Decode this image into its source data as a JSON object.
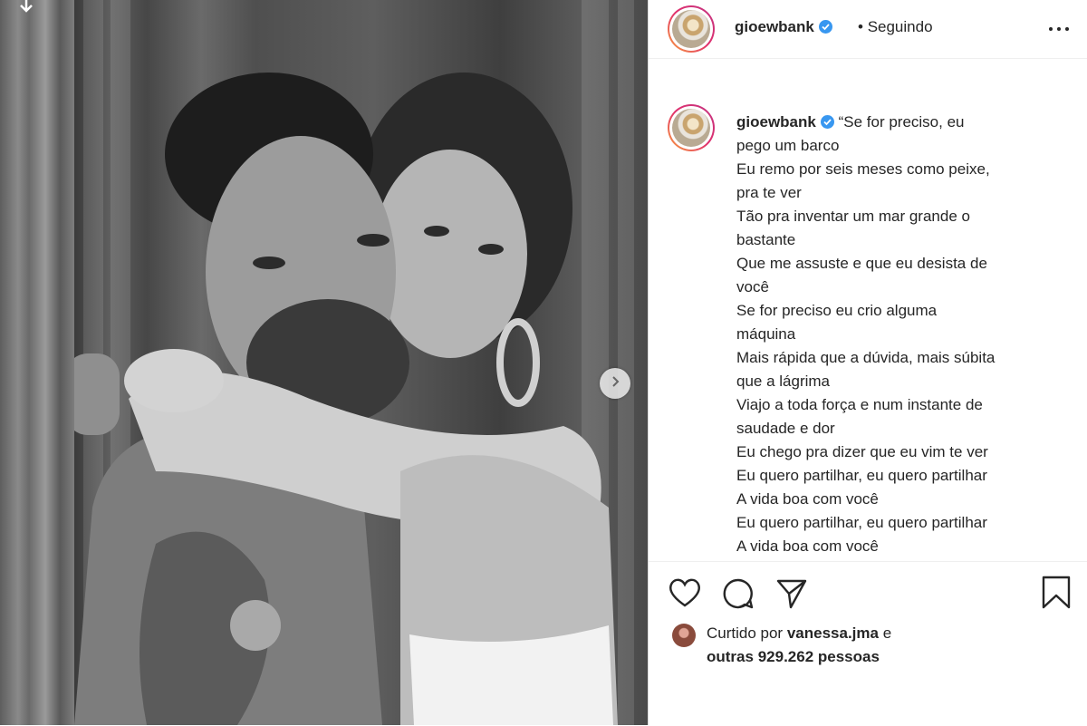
{
  "post": {
    "username": "gioewbank",
    "follow_separator": "•",
    "follow_status": "Seguindo",
    "caption_lines": [
      "“Se for preciso, eu",
      "pego um barco",
      "Eu remo por seis meses como peixe,",
      "pra te ver",
      "Tão pra inventar um mar grande o",
      "bastante",
      "Que me assuste e que eu desista de",
      "você",
      "Se for preciso eu crio alguma",
      "máquina",
      "Mais rápida que a dúvida, mais súbita",
      "que a lágrima",
      "Viajo a toda força e num instante de",
      "saudade e dor",
      "Eu chego pra dizer que eu vim te ver",
      "Eu quero partilhar, eu quero partilhar",
      "A vida boa com você",
      "Eu quero partilhar, eu quero partilhar",
      "A vida boa com você"
    ],
    "likes": {
      "prefix": "Curtido por",
      "liked_by": "vanessa.jma",
      "connector": "e",
      "others_prefix": "outras",
      "count": "929.262",
      "others_suffix": "pessoas"
    }
  },
  "icons": {
    "verified": "verified-badge-icon",
    "more": "more-options-icon",
    "like": "heart-icon",
    "comment": "comment-bubble-icon",
    "share": "paper-plane-icon",
    "save": "bookmark-icon",
    "next": "chevron-right-icon",
    "download": "arrow-down-icon"
  },
  "colors": {
    "verified_blue": "#3897f0",
    "text": "#262626",
    "border": "#dbdbdb",
    "story_ring_start": "#f9a23c",
    "story_ring_end": "#c13584"
  }
}
